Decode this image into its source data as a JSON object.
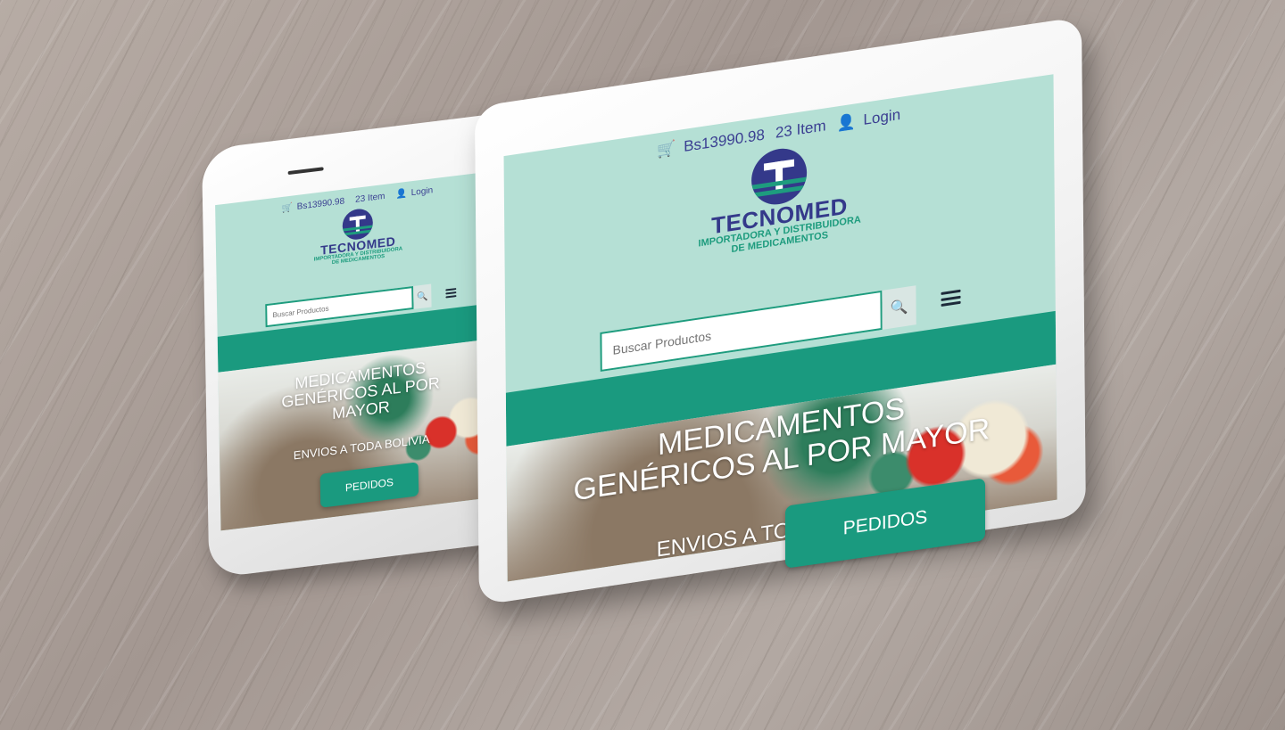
{
  "site": {
    "cart_total": "Bs13990.98",
    "items": "23 Item",
    "login": "Login",
    "brand": "TECNOMED",
    "tagline_1": "IMPORTADORA Y DISTRIBUIDORA",
    "tagline_2": "DE MEDICAMENTOS",
    "search_placeholder": "Buscar Productos",
    "hero_title": "MEDICAMENTOS GENÉRICOS AL POR MAYOR",
    "hero_subtitle": "ENVIOS A TODA BOLIVIA",
    "cta": "PEDIDOS"
  },
  "colors": {
    "header_bg": "#b5e0d5",
    "brand_blue": "#34398a",
    "brand_green": "#1a9a7f"
  },
  "icons": [
    "cart-icon",
    "user-icon",
    "search-icon",
    "hamburger-menu-icon"
  ]
}
